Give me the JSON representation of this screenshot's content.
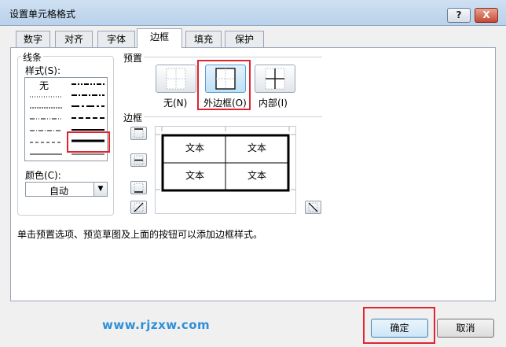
{
  "window": {
    "title": "设置单元格格式",
    "help_label": "?",
    "close_label": "X"
  },
  "tabs": [
    {
      "label": "数字"
    },
    {
      "label": "对齐"
    },
    {
      "label": "字体"
    },
    {
      "label": "边框",
      "active": true
    },
    {
      "label": "填充"
    },
    {
      "label": "保护"
    }
  ],
  "line_group": {
    "title": "线条",
    "style_label": "样式(S):",
    "none_label": "无",
    "color_label": "颜色(C):",
    "color_value": "自动"
  },
  "presets": {
    "title": "预置",
    "none_label": "无(N)",
    "outline_label": "外边框(O)",
    "inside_label": "内部(I)"
  },
  "border": {
    "title": "边框",
    "preview_cells": [
      "文本",
      "文本",
      "文本",
      "文本"
    ]
  },
  "hint_text": "单击预置选项、预览草图及上面的按钮可以添加边框样式。",
  "buttons": {
    "ok_label": "确定",
    "cancel_label": "取消"
  },
  "watermark": "www.rjzxw.com",
  "colors": {
    "highlight_red": "#e0242e",
    "watermark_blue": "#2f8fd8",
    "dialog_bg": "#f0f0f0"
  }
}
